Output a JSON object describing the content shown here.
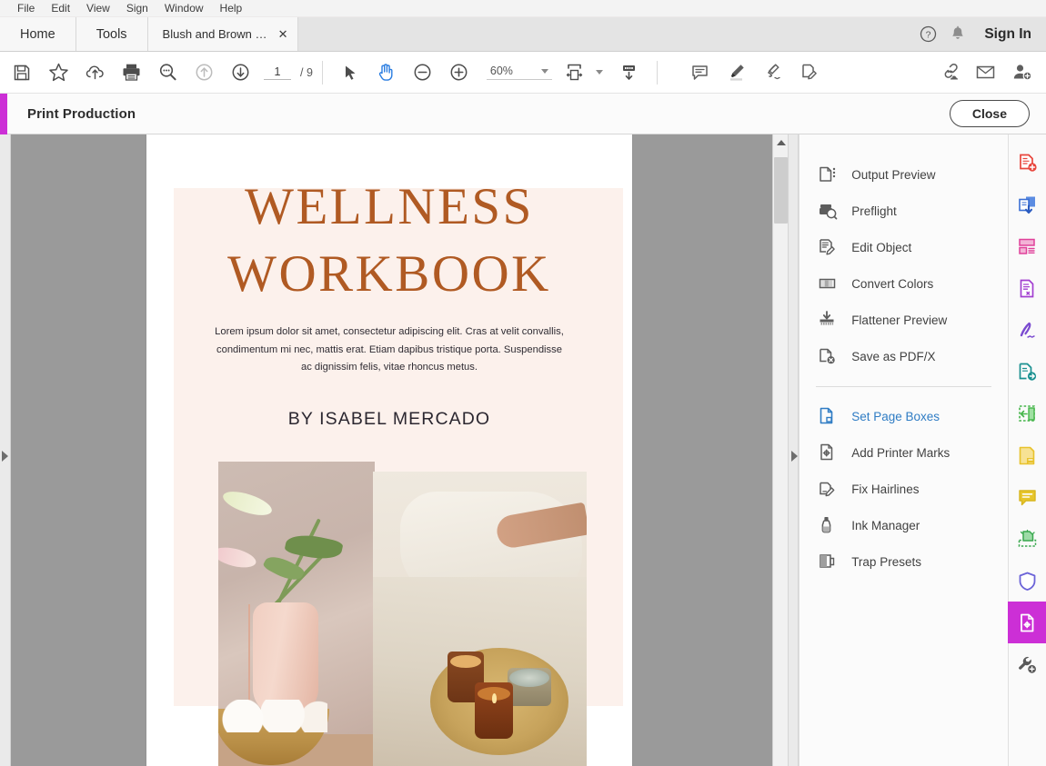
{
  "menubar": {
    "items": [
      {
        "label": "File"
      },
      {
        "label": "Edit"
      },
      {
        "label": "View"
      },
      {
        "label": "Sign"
      },
      {
        "label": "Window"
      },
      {
        "label": "Help"
      }
    ]
  },
  "tabstrip": {
    "home_label": "Home",
    "tools_label": "Tools",
    "document_tab": {
      "label": "Blush and Brown Si...",
      "close": "✕"
    },
    "sign_in_label": "Sign In",
    "help_icon": "help-circle-icon",
    "bell_icon": "notification-bell-icon"
  },
  "toolbar": {
    "save_icon": "save-floppy-icon",
    "star_icon": "add-to-favorites-star-icon",
    "cloud_icon": "upload-to-cloud-icon",
    "print_icon": "print-icon",
    "search_icon": "search-magnifier-icon",
    "prev_icon": "previous-page-arrow-up-icon",
    "next_icon": "next-page-arrow-down-icon",
    "page_value": "1",
    "page_total": "/ 9",
    "select_icon": "select-cursor-icon",
    "pan_icon": "hand-pan-icon",
    "zoom_out_icon": "zoom-out-minus-icon",
    "zoom_in_icon": "zoom-in-plus-icon",
    "zoom_value": "60%",
    "fit_icon": "fit-page-width-icon",
    "scroll_icon": "scroll-mode-icon",
    "comment_icon": "add-comment-icon",
    "highlight_icon": "highlight-text-icon",
    "sign_icon": "sign-document-icon",
    "fill_sign_icon": "fill-and-sign-icon",
    "share_link_icon": "share-link-icon",
    "email_icon": "email-document-icon",
    "add_person_icon": "add-person-icon"
  },
  "print_production": {
    "title": "Print Production",
    "close_label": "Close",
    "accent_color": "#cc2fd6",
    "group_one": [
      {
        "label": "Output Preview",
        "icon": "output-preview-icon",
        "active": false
      },
      {
        "label": "Preflight",
        "icon": "preflight-icon",
        "active": false
      },
      {
        "label": "Edit Object",
        "icon": "edit-object-icon",
        "active": false
      },
      {
        "label": "Convert Colors",
        "icon": "convert-colors-icon",
        "active": false
      },
      {
        "label": "Flattener Preview",
        "icon": "flattener-preview-icon",
        "active": false
      },
      {
        "label": "Save as PDF/X",
        "icon": "save-as-pdfx-icon",
        "active": false
      }
    ],
    "group_two": [
      {
        "label": "Set Page Boxes",
        "icon": "set-page-boxes-icon",
        "active": true
      },
      {
        "label": "Add Printer Marks",
        "icon": "add-printer-marks-icon",
        "active": false
      },
      {
        "label": "Fix Hairlines",
        "icon": "fix-hairlines-icon",
        "active": false
      },
      {
        "label": "Ink Manager",
        "icon": "ink-manager-icon",
        "active": false
      },
      {
        "label": "Trap Presets",
        "icon": "trap-presets-icon",
        "active": false
      }
    ],
    "active_link_color": "#2f7cc4"
  },
  "tool_rail": {
    "items": [
      {
        "name": "create-pdf-icon",
        "color": "#e8453c",
        "selected": false
      },
      {
        "name": "export-pdf-icon",
        "color": "#3b6fd4",
        "selected": false
      },
      {
        "name": "organize-pages-icon",
        "color": "#e0419a",
        "selected": false
      },
      {
        "name": "edit-pdf-icon",
        "color": "#a23fd0",
        "selected": false
      },
      {
        "name": "fill-and-sign-icon",
        "color": "#7a4ad0",
        "selected": false
      },
      {
        "name": "send-for-signature-icon",
        "color": "#1a9090",
        "selected": false
      },
      {
        "name": "compress-pdf-icon",
        "color": "#45b54a",
        "selected": false
      },
      {
        "name": "comment-note-icon",
        "color": "#e8c22c",
        "selected": false
      },
      {
        "name": "comment-bubble-icon",
        "color": "#d8b61f",
        "selected": false
      },
      {
        "name": "scan-and-ocr-icon",
        "color": "#3aa84f",
        "selected": false
      },
      {
        "name": "protect-shield-icon",
        "color": "#6b63d8",
        "selected": false
      },
      {
        "name": "print-production-icon",
        "color": "#ffffff",
        "selected": true
      },
      {
        "name": "more-tools-wrench-icon",
        "color": "#5a5a5a",
        "selected": false
      }
    ]
  },
  "viewer": {
    "left_collapse_icon": "expand-left-panel-arrow-icon",
    "right_collapse_icon": "expand-right-panel-arrow-icon",
    "scroll_up_icon": "scroll-up-arrow-icon",
    "scrollbar": "vertical-scrollbar"
  },
  "document": {
    "title_line1": "WELLNESS",
    "title_line2": "WORKBOOK",
    "body": "Lorem ipsum dolor sit amet, consectetur adipiscing elit. Cras at velit convallis, condimentum mi nec, mattis erat. Etiam dapibus tristique porta. Suspendisse ac dignissim felis, vitae rhoncus metus.",
    "author": "BY ISABEL MERCADO",
    "title_color": "#b05a23",
    "panel_color": "#fcf1ec",
    "photo_one": "flowers-in-pink-vase-photo",
    "photo_two": "candles-on-tray-with-bedding-photo"
  }
}
